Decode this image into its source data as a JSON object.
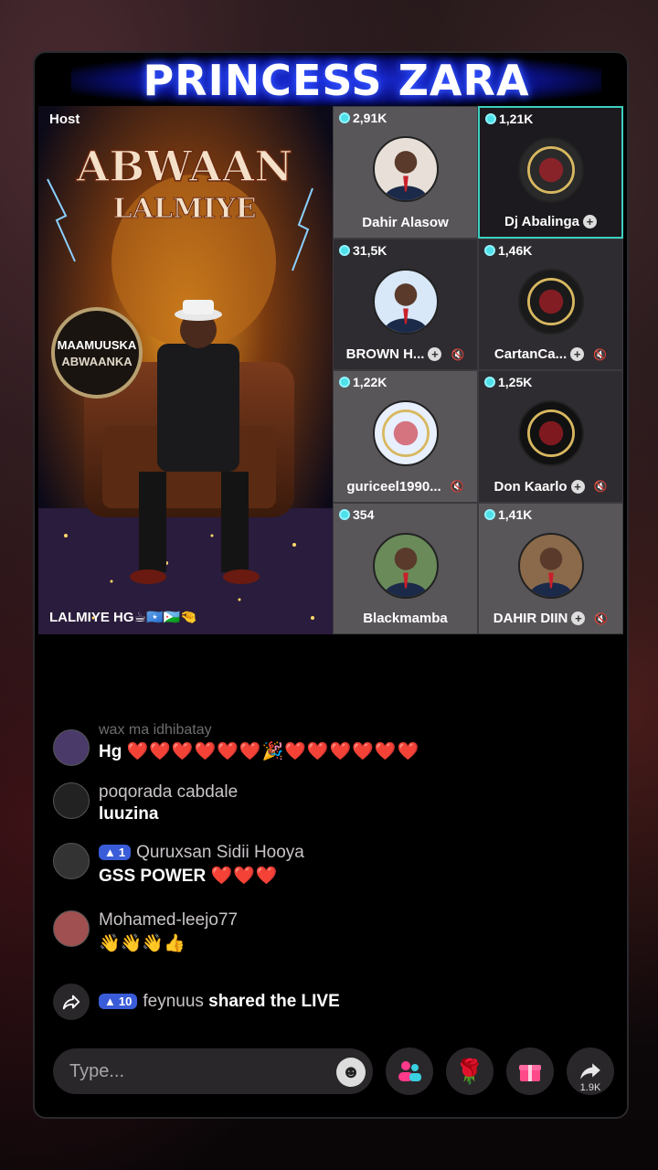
{
  "banner": {
    "title": "PRINCESS ZARA"
  },
  "host": {
    "label": "Host",
    "name": "LALMIYE HG☕🇸🇴🇩🇯🤏",
    "art_title": "ABWAAN",
    "art_subtitle": "LALMIYE",
    "badge_line1": "MAAMUUSKA",
    "badge_line2": "ABWAANKA"
  },
  "guests": [
    {
      "count": "2,91K",
      "name": "Dahir Alasow",
      "plus": false,
      "mute": false,
      "avatar": "person-icon",
      "tone": "light"
    },
    {
      "count": "1,21K",
      "name": "Dj Abalinga",
      "plus": true,
      "mute": false,
      "avatar": "arsenal-logo-icon",
      "tone": "active"
    },
    {
      "count": "31,5K",
      "name": "BROWN H...",
      "plus": true,
      "mute": true,
      "avatar": "person-icon",
      "tone": "dark"
    },
    {
      "count": "1,46K",
      "name": "CartanCa...",
      "plus": true,
      "mute": true,
      "avatar": "badge-logo-icon",
      "tone": "dark"
    },
    {
      "count": "1,22K",
      "name": "guriceel1990...",
      "plus": false,
      "mute": true,
      "avatar": "official-logo-icon",
      "tone": "light"
    },
    {
      "count": "1,25K",
      "name": "Don Kaarlo",
      "plus": true,
      "mute": true,
      "avatar": "badge-logo-icon",
      "tone": "dark"
    },
    {
      "count": "354",
      "name": "Blackmamba",
      "plus": false,
      "mute": false,
      "avatar": "person-icon",
      "tone": "light"
    },
    {
      "count": "1,41K",
      "name": "DAHIR DIIN",
      "plus": true,
      "mute": true,
      "avatar": "person-icon",
      "tone": "light"
    }
  ],
  "chat": [
    {
      "user": "wax ma idhibatay",
      "text": "Hg",
      "emojis": "❤️❤️❤️❤️❤️❤️🎉❤️❤️❤️❤️❤️❤️",
      "level": ""
    },
    {
      "user": "poqorada cabdale",
      "text": "luuzina",
      "emojis": "",
      "level": ""
    },
    {
      "user": "Quruxsan Sidii Hooya",
      "text": "GSS POWER",
      "emojis": "❤️❤️❤️",
      "level": "1"
    },
    {
      "user": "Mohamed-leejo77",
      "text": "",
      "emojis": "👋👋👋👍",
      "level": ""
    }
  ],
  "share_event": {
    "level": "10",
    "user": "feynuus",
    "text": "shared the LIVE"
  },
  "bottom": {
    "placeholder": "Type...",
    "share_count": "1.9K"
  },
  "colors": {
    "banner_glow": "#2040ff",
    "gem": "#4ee0e8",
    "level_badge": "#3a5cd8",
    "heart": "#ff2a4a",
    "active_border": "#3bd0c0"
  }
}
